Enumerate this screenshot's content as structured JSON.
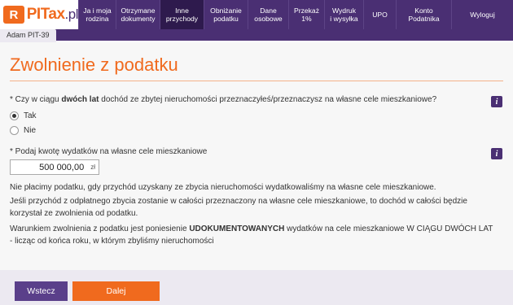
{
  "logo": {
    "badge": "R",
    "name": "PITax",
    "suffix": ".pl"
  },
  "nav": [
    {
      "line1": "Ja i moja",
      "line2": "rodzina",
      "active": false
    },
    {
      "line1": "Otrzymane",
      "line2": "dokumenty",
      "active": false
    },
    {
      "line1": "Inne",
      "line2": "przychody",
      "active": true
    },
    {
      "line1": "Obniżanie",
      "line2": "podatku",
      "active": false
    },
    {
      "line1": "Dane",
      "line2": "osobowe",
      "active": false
    },
    {
      "line1": "Przekaż",
      "line2": "1%",
      "active": false
    },
    {
      "line1": "Wydruk",
      "line2": "i wysyłka",
      "active": false
    },
    {
      "line1": "UPO",
      "line2": "",
      "active": false
    },
    {
      "line1": "Konto",
      "line2": "Podatnika",
      "active": false
    },
    {
      "line1": "Wyloguj",
      "line2": "",
      "active": false
    }
  ],
  "user_tab": "Adam PIT-39",
  "page_title": "Zwolnienie z podatku",
  "question1": {
    "prefix": "* Czy w ciągu ",
    "bold": "dwóch lat",
    "suffix": " dochód ze zbytej nieruchomości przeznaczyłeś/przeznaczysz na własne cele mieszkaniowe?",
    "options": [
      {
        "label": "Tak",
        "checked": true
      },
      {
        "label": "Nie",
        "checked": false
      }
    ]
  },
  "question2": {
    "label": "* Podaj kwotę wydatków na własne cele mieszkaniowe",
    "value": "500 000,00",
    "currency": "zł"
  },
  "info_icon": "i",
  "paragraphs": {
    "p1": "Nie płacimy podatku, gdy przychód uzyskany ze zbycia nieruchomości wydatkowaliśmy na własne cele mieszkaniowe.",
    "p2": "Jeśli przychód z odpłatnego zbycia zostanie w całości przeznaczony na własne cele mieszkaniowe, to dochód w całości będzie korzystał ze zwolnienia od podatku.",
    "p3_prefix": "Warunkiem zwolnienia z podatku jest poniesienie ",
    "p3_bold": "UDOKUMENTOWANYCH",
    "p3_suffix": " wydatków na cele mieszkaniowe W CIĄGU DWÓCH LAT - licząc od końca roku, w którym zbyliśmy nieruchomości"
  },
  "buttons": {
    "back": "Wstecz",
    "next": "Dalej"
  },
  "colors": {
    "brand_purple": "#4a2f73",
    "brand_orange": "#f06a1e"
  }
}
